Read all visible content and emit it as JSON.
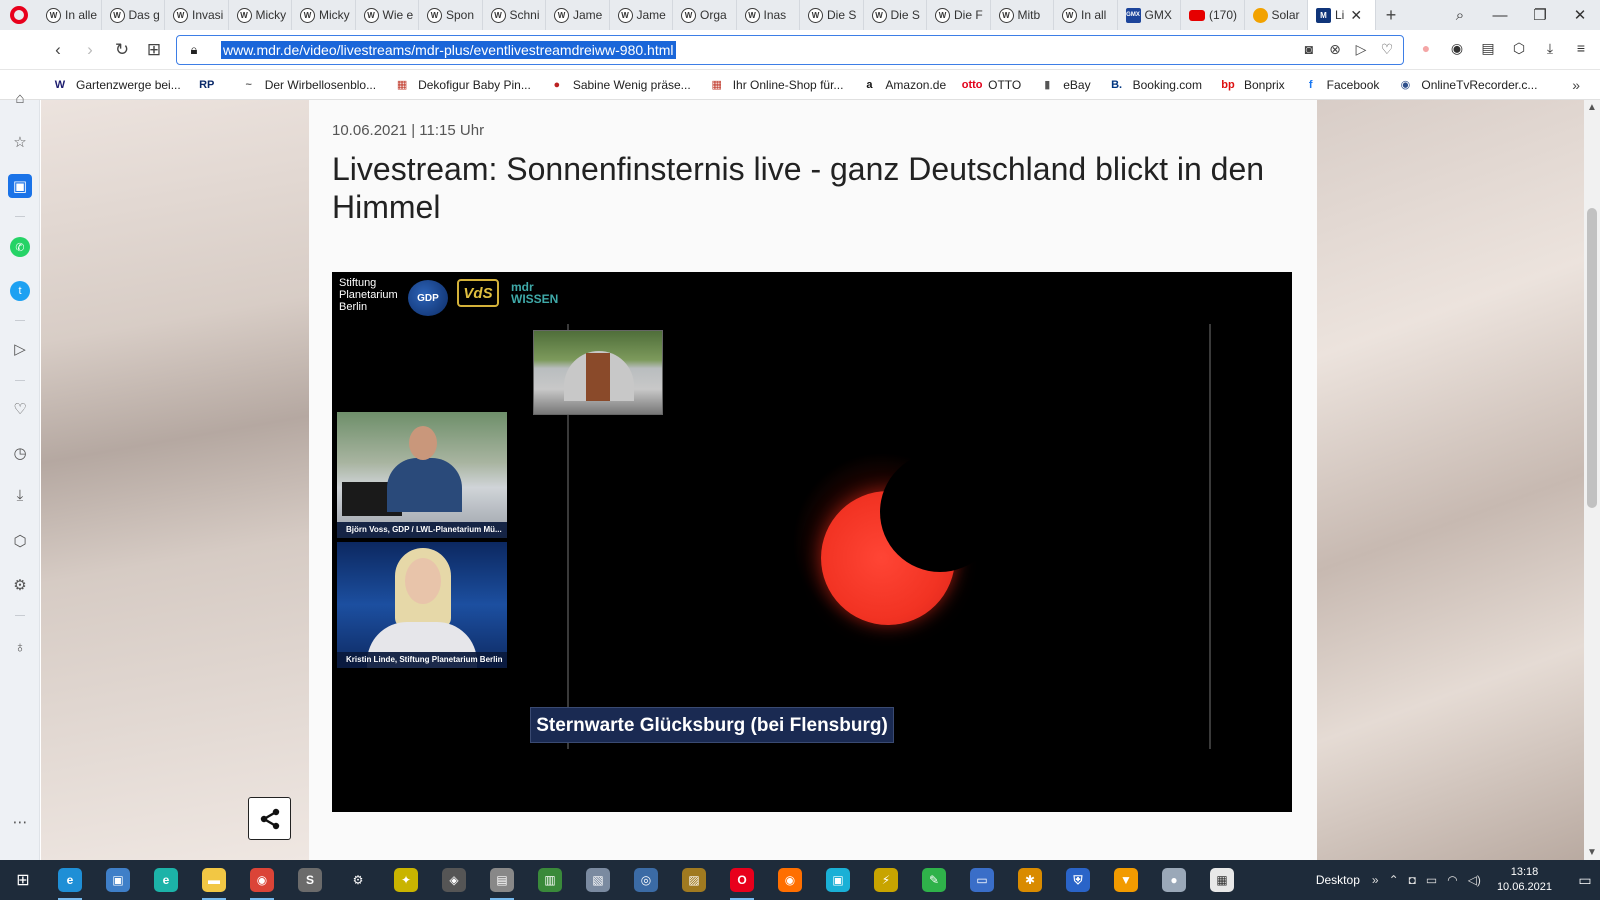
{
  "tabs": [
    {
      "label": "In alle",
      "icon": "wiki"
    },
    {
      "label": "Das g",
      "icon": "wiki"
    },
    {
      "label": "Invasi",
      "icon": "wiki"
    },
    {
      "label": "Micky",
      "icon": "wiki"
    },
    {
      "label": "Micky",
      "icon": "wiki"
    },
    {
      "label": "Wie e",
      "icon": "wiki"
    },
    {
      "label": "Spon",
      "icon": "wiki"
    },
    {
      "label": "Schni",
      "icon": "wiki"
    },
    {
      "label": "Jame",
      "icon": "wiki"
    },
    {
      "label": "Jame",
      "icon": "wiki"
    },
    {
      "label": "Orga",
      "icon": "wiki"
    },
    {
      "label": "Inas",
      "icon": "wiki"
    },
    {
      "label": "Die S",
      "icon": "wiki"
    },
    {
      "label": "Die S",
      "icon": "wiki"
    },
    {
      "label": "Die F",
      "icon": "wiki"
    },
    {
      "label": "Mitb",
      "icon": "wiki"
    },
    {
      "label": "In all",
      "icon": "wiki"
    },
    {
      "label": "GMX",
      "icon": "gmx"
    },
    {
      "label": "(170)",
      "icon": "yt"
    },
    {
      "label": "Solar",
      "icon": "solar"
    }
  ],
  "active_tab": {
    "label": "Li"
  },
  "address": {
    "url": "www.mdr.de/video/livestreams/mdr-plus/eventlivestreamdreiww-980.html"
  },
  "bookmarks": [
    {
      "label": "Gartenzwerge bei...",
      "icon": "W",
      "color": "#1b1b6e"
    },
    {
      "label": "",
      "icon": "RP",
      "color": "#0a2a6a"
    },
    {
      "label": "Der Wirbellosenblo...",
      "icon": "~",
      "color": "#666"
    },
    {
      "label": "Dekofigur Baby Pin...",
      "icon": "▦",
      "color": "#c0392b"
    },
    {
      "label": "Sabine Wenig präse...",
      "icon": "●",
      "color": "#b22"
    },
    {
      "label": "Ihr Online-Shop für...",
      "icon": "▦",
      "color": "#c0392b"
    },
    {
      "label": "Amazon.de",
      "icon": "a",
      "color": "#111"
    },
    {
      "label": "OTTO",
      "icon": "otto",
      "color": "#e2001a"
    },
    {
      "label": "eBay",
      "icon": "▮",
      "color": "#555"
    },
    {
      "label": "Booking.com",
      "icon": "B.",
      "color": "#003580"
    },
    {
      "label": "Bonprix",
      "icon": "bp",
      "color": "#d11"
    },
    {
      "label": "Facebook",
      "icon": "f",
      "color": "#1877f2"
    },
    {
      "label": "OnlineTvRecorder.c...",
      "icon": "◉",
      "color": "#2e4f8c"
    }
  ],
  "article": {
    "date": "10.06.2021 | 11:15 Uhr",
    "title": "Livestream: Sonnenfinsternis live - ganz Deutschland blickt in den Himmel"
  },
  "video": {
    "logo_planetarium": "Stiftung\nPlanetarium\nBerlin",
    "logo_gdp": "GDP",
    "logo_vds": "VdS",
    "logo_mdr_top": "mdr",
    "logo_mdr_bottom": "WISSEN",
    "caption_1": "Björn Voss, GDP / LWL-Planetarium Mü...",
    "caption_2": "Kristin Linde, Stiftung Planetarium Berlin",
    "location": "Sternwarte Glücksburg (bei Flensburg)"
  },
  "taskbar": {
    "desktop_label": "Desktop",
    "time": "13:18",
    "date": "10.06.2021",
    "apps": [
      {
        "name": "edge",
        "color": "#1f8fd6",
        "glyph": "e"
      },
      {
        "name": "explorer-window",
        "color": "#3f7fc8",
        "glyph": "▣"
      },
      {
        "name": "edge-legacy",
        "color": "#1cb3a8",
        "glyph": "e"
      },
      {
        "name": "file-explorer",
        "color": "#f2c744",
        "glyph": "▬"
      },
      {
        "name": "chrome",
        "color": "#db4437",
        "glyph": "◉"
      },
      {
        "name": "app-s",
        "color": "#6b6b6b",
        "glyph": "S"
      },
      {
        "name": "settings",
        "color": "#1e2b3a",
        "glyph": "⚙"
      },
      {
        "name": "app-tools",
        "color": "#c9b400",
        "glyph": "✦"
      },
      {
        "name": "app-viewer",
        "color": "#555",
        "glyph": "◈"
      },
      {
        "name": "app-window",
        "color": "#888",
        "glyph": "▤"
      },
      {
        "name": "app-network",
        "color": "#3a8a3a",
        "glyph": "▥"
      },
      {
        "name": "app-tool2",
        "color": "#7a8aa0",
        "glyph": "▧"
      },
      {
        "name": "app-disc",
        "color": "#3b6ba5",
        "glyph": "◎"
      },
      {
        "name": "app-archive",
        "color": "#a07a20",
        "glyph": "▨"
      },
      {
        "name": "opera",
        "color": "#e8001c",
        "glyph": "O"
      },
      {
        "name": "firefox",
        "color": "#ff6f00",
        "glyph": "◉"
      },
      {
        "name": "app-store",
        "color": "#1ab0d6",
        "glyph": "▣"
      },
      {
        "name": "app-flash",
        "color": "#c8a400",
        "glyph": "⚡"
      },
      {
        "name": "app-green",
        "color": "#2fb24a",
        "glyph": "✎"
      },
      {
        "name": "app-monitor",
        "color": "#3a6ec8",
        "glyph": "▭"
      },
      {
        "name": "app-spark",
        "color": "#d98b00",
        "glyph": "✱"
      },
      {
        "name": "app-shield",
        "color": "#2a64c8",
        "glyph": "⛨"
      },
      {
        "name": "app-vpn",
        "color": "#f29b00",
        "glyph": "▼"
      },
      {
        "name": "app-globe",
        "color": "#9aa8b8",
        "glyph": "●"
      },
      {
        "name": "ms-store",
        "color": "#e8e8e8",
        "glyph": "▦"
      }
    ]
  },
  "colors": {
    "accent": "#1a73e8",
    "opera_red": "#e8001c",
    "sun": "#f23323"
  }
}
